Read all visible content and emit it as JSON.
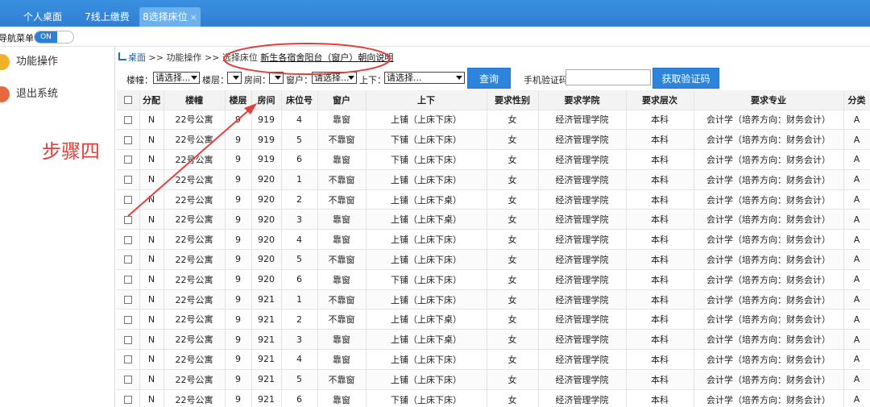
{
  "tabs": [
    {
      "label": "个人桌面"
    },
    {
      "label": "7线上缴费"
    },
    {
      "label": "8选择床位",
      "close": "×"
    }
  ],
  "nav": {
    "label": "导航菜单",
    "toggle": "ON"
  },
  "sidebar": {
    "items": [
      {
        "label": "功能操作"
      },
      {
        "label": "退出系统"
      }
    ]
  },
  "annotation": {
    "step_text": "步骤四",
    "color": "#e2403c"
  },
  "breadcrumb": {
    "home": "桌面",
    "sep": ">>",
    "item1": "功能操作",
    "item2": "选择床位",
    "link": "新生各宿舍阳台（窗户）朝向说明"
  },
  "filters": {
    "building_label": "楼幢：",
    "building_value": "请选择...",
    "floor_label": "楼层：",
    "room_label": "房间：",
    "window_label": "窗户：",
    "window_value": "请选择...",
    "bunk_label": "上下：",
    "bunk_value": "请选择...",
    "query_button": "查询",
    "phone_label": "手机验证码:",
    "phone_value": "",
    "get_code_button": "获取验证码"
  },
  "table": {
    "headers": [
      "",
      "分配",
      "楼幢",
      "楼层",
      "房间",
      "床位号",
      "窗户",
      "上下",
      "要求性别",
      "要求学院",
      "要求层次",
      "要求专业",
      "分类"
    ],
    "rows": [
      [
        "N",
        "22号公寓",
        "9",
        "919",
        "4",
        "靠窗",
        "上铺（上床下床）",
        "女",
        "经济管理学院",
        "本科",
        "会计学（培养方向：财务会计）",
        "A"
      ],
      [
        "N",
        "22号公寓",
        "9",
        "919",
        "5",
        "不靠窗",
        "下铺（上床下床）",
        "女",
        "经济管理学院",
        "本科",
        "会计学（培养方向：财务会计）",
        "A"
      ],
      [
        "N",
        "22号公寓",
        "9",
        "919",
        "6",
        "靠窗",
        "下铺（上床下床）",
        "女",
        "经济管理学院",
        "本科",
        "会计学（培养方向：财务会计）",
        "A"
      ],
      [
        "N",
        "22号公寓",
        "9",
        "920",
        "1",
        "不靠窗",
        "上铺（上床下床）",
        "女",
        "经济管理学院",
        "本科",
        "会计学（培养方向：财务会计）",
        "A"
      ],
      [
        "N",
        "22号公寓",
        "9",
        "920",
        "2",
        "不靠窗",
        "上铺（上床下桌）",
        "女",
        "经济管理学院",
        "本科",
        "会计学（培养方向：财务会计）",
        "A"
      ],
      [
        "N",
        "22号公寓",
        "9",
        "920",
        "3",
        "靠窗",
        "上铺（上床下桌）",
        "女",
        "经济管理学院",
        "本科",
        "会计学（培养方向：财务会计）",
        "A"
      ],
      [
        "N",
        "22号公寓",
        "9",
        "920",
        "4",
        "靠窗",
        "上铺（上床下床）",
        "女",
        "经济管理学院",
        "本科",
        "会计学（培养方向：财务会计）",
        "A"
      ],
      [
        "N",
        "22号公寓",
        "9",
        "920",
        "5",
        "不靠窗",
        "上铺（上床下床）",
        "女",
        "经济管理学院",
        "本科",
        "会计学（培养方向：财务会计）",
        "A"
      ],
      [
        "N",
        "22号公寓",
        "9",
        "920",
        "6",
        "靠窗",
        "下铺（上床下床）",
        "女",
        "经济管理学院",
        "本科",
        "会计学（培养方向：财务会计）",
        "A"
      ],
      [
        "N",
        "22号公寓",
        "9",
        "921",
        "1",
        "不靠窗",
        "上铺（上床下床）",
        "女",
        "经济管理学院",
        "本科",
        "会计学（培养方向：财务会计）",
        "A"
      ],
      [
        "N",
        "22号公寓",
        "9",
        "921",
        "2",
        "不靠窗",
        "上铺（上床下桌）",
        "女",
        "经济管理学院",
        "本科",
        "会计学（培养方向：财务会计）",
        "A"
      ],
      [
        "N",
        "22号公寓",
        "9",
        "921",
        "3",
        "靠窗",
        "上铺（上床下桌）",
        "女",
        "经济管理学院",
        "本科",
        "会计学（培养方向：财务会计）",
        "A"
      ],
      [
        "N",
        "22号公寓",
        "9",
        "921",
        "4",
        "靠窗",
        "上铺（上床下床）",
        "女",
        "经济管理学院",
        "本科",
        "会计学（培养方向：财务会计）",
        "A"
      ],
      [
        "N",
        "22号公寓",
        "9",
        "921",
        "5",
        "不靠窗",
        "上铺（上床下床）",
        "女",
        "经济管理学院",
        "本科",
        "会计学（培养方向：财务会计）",
        "A"
      ],
      [
        "N",
        "22号公寓",
        "9",
        "921",
        "6",
        "靠窗",
        "下铺（上床下床）",
        "女",
        "经济管理学院",
        "本科",
        "会计学（培养方向：财务会计）",
        "A"
      ]
    ]
  },
  "colors": {
    "accent": "#2c84db",
    "tabbar": "#3a8fe0",
    "annotation": "#e2403c"
  }
}
